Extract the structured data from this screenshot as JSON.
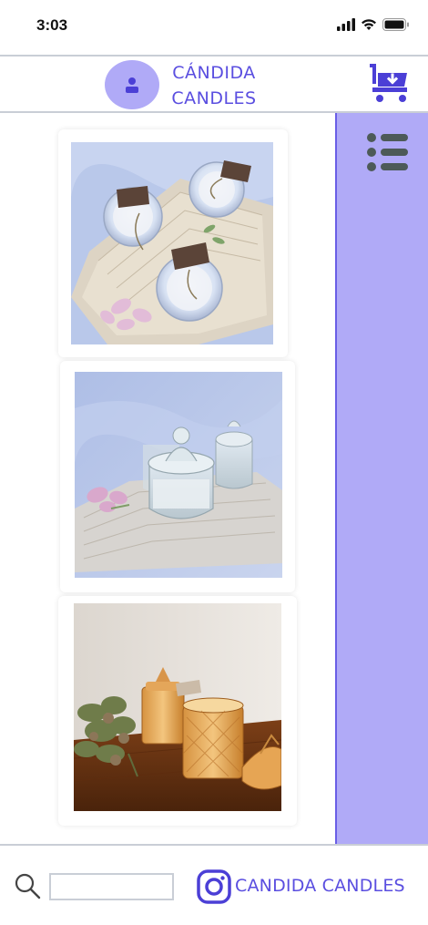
{
  "status_bar": {
    "time": "3:03",
    "icons": [
      "signal-icon",
      "wifi-icon",
      "battery-icon"
    ]
  },
  "header": {
    "brand_line1": "CÁNDIDA",
    "brand_line2": "CANDLES",
    "avatar_icon": "user-icon",
    "cart_icon": "cart-icon"
  },
  "gallery": {
    "photos": [
      {
        "alt": "Three glass candle jars with tags on lace doily with pink flowers"
      },
      {
        "alt": "Glass candle jars on lace cloth with pink flowers"
      },
      {
        "alt": "Amber glass candle jars on wooden table with dried flowers"
      }
    ]
  },
  "sidebar": {
    "menu_icon": "list-icon"
  },
  "footer": {
    "search_icon": "search-icon",
    "search_value": "",
    "instagram_icon": "instagram-icon",
    "instagram_label": "CANDIDA CANDLES"
  },
  "colors": {
    "accent": "#b0aaf7",
    "brand_text": "#5a4ee0",
    "divider": "#c9ced6",
    "icon_dark": "#4d5a58"
  }
}
